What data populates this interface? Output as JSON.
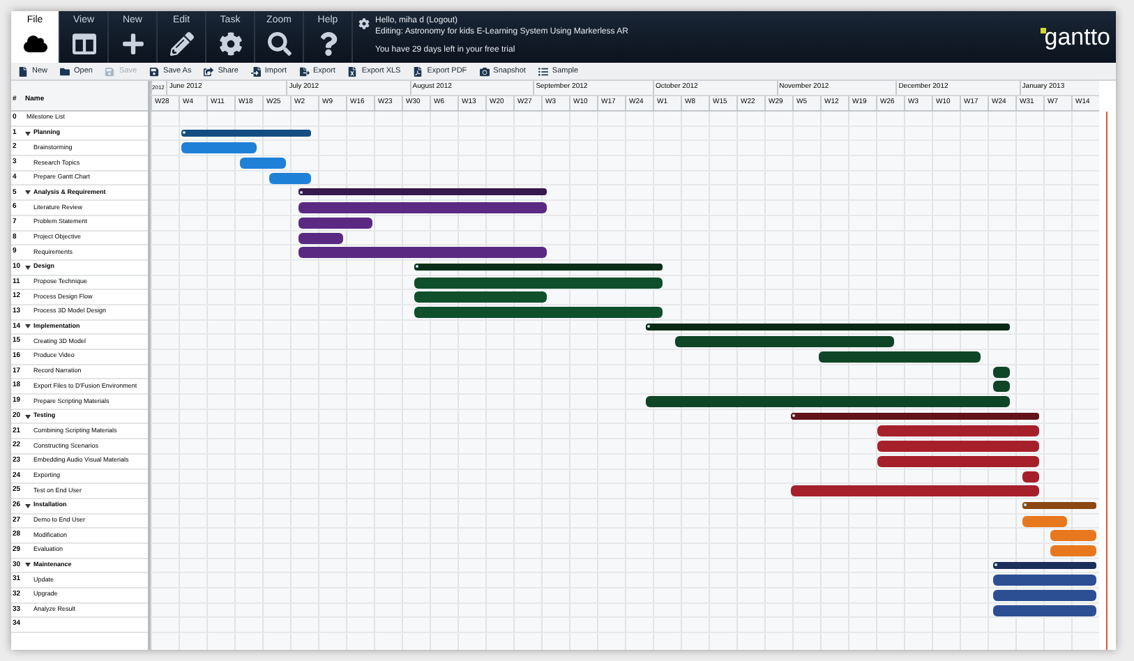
{
  "tabs": [
    {
      "label": "File",
      "selected": true
    },
    {
      "label": "View",
      "selected": false
    },
    {
      "label": "New",
      "selected": false
    },
    {
      "label": "Edit",
      "selected": false
    },
    {
      "label": "Task",
      "selected": false
    },
    {
      "label": "Zoom",
      "selected": false
    },
    {
      "label": "Help",
      "selected": false
    }
  ],
  "user": {
    "greeting": "Hello, miha d (Logout)",
    "editing": "Editing: Astronomy for kids E-Learning System Using Markerless AR",
    "trial": "You have 29 days left in your free trial"
  },
  "logo": "gantto",
  "toolbar": [
    {
      "label": "New",
      "disabled": false
    },
    {
      "label": "Open",
      "disabled": false
    },
    {
      "label": "Save",
      "disabled": true
    },
    {
      "label": "Save As",
      "disabled": false
    },
    {
      "label": "Share",
      "disabled": false
    },
    {
      "label": "Import",
      "disabled": false
    },
    {
      "label": "Export",
      "disabled": false
    },
    {
      "label": "Export XLS",
      "disabled": false
    },
    {
      "label": "Export PDF",
      "disabled": false
    },
    {
      "label": "Snapshot",
      "disabled": false
    },
    {
      "label": "Sample",
      "disabled": false
    }
  ],
  "columns": [
    "#",
    "Name"
  ],
  "timeline": {
    "months": [
      "2012",
      "June 2012",
      "July 2012",
      "August 2012",
      "September 2012",
      "October 2012",
      "November 2012",
      "December 2012",
      "January 2013"
    ],
    "weeks": [
      "W28",
      "W4",
      "W11",
      "W18",
      "W25",
      "W2",
      "W9",
      "W16",
      "W23",
      "W30",
      "W6",
      "W13",
      "W20",
      "W27",
      "W3",
      "W10",
      "W17",
      "W24",
      "W1",
      "W8",
      "W15",
      "W22",
      "W29",
      "W5",
      "W12",
      "W19",
      "W26",
      "W3",
      "W10",
      "W17",
      "W24",
      "W31",
      "W7",
      "W14"
    ]
  },
  "tasks": [
    {
      "id": "0",
      "name": "Milestone List",
      "kind": "list"
    },
    {
      "id": "1",
      "name": "Planning",
      "kind": "group",
      "expanded": true,
      "color": "#1f80d8",
      "children": [
        {
          "id": "2",
          "name": "Brainstorming",
          "kind": "task"
        },
        {
          "id": "3",
          "name": "Research Topics",
          "kind": "task"
        },
        {
          "id": "4",
          "name": "Prepare Gantt Chart",
          "kind": "task"
        }
      ]
    },
    {
      "id": "5",
      "name": "Analysis & Requirement",
      "kind": "group",
      "expanded": true,
      "color": "#5a2a82",
      "children": [
        {
          "id": "6",
          "name": "Literature Review",
          "kind": "task"
        },
        {
          "id": "7",
          "name": "Problem Statement",
          "kind": "task"
        },
        {
          "id": "8",
          "name": "Project Objective",
          "kind": "task"
        },
        {
          "id": "9",
          "name": "Requirements",
          "kind": "task"
        }
      ]
    },
    {
      "id": "10",
      "name": "Design",
      "kind": "group",
      "expanded": true,
      "color": "#0f4f2c",
      "children": [
        {
          "id": "11",
          "name": "Propose Technique",
          "kind": "task"
        },
        {
          "id": "12",
          "name": "Process Design Flow",
          "kind": "task"
        },
        {
          "id": "13",
          "name": "Process 3D Model Design",
          "kind": "task"
        }
      ]
    },
    {
      "id": "14",
      "name": "Implementation",
      "kind": "group",
      "expanded": true,
      "color": "#0e4526",
      "children": [
        {
          "id": "15",
          "name": "Creating 3D Model",
          "kind": "task"
        },
        {
          "id": "16",
          "name": "Produce Video",
          "kind": "task"
        },
        {
          "id": "17",
          "name": "Record Narration",
          "kind": "task"
        },
        {
          "id": "18",
          "name": "Export Files to D'Fusion Environment",
          "kind": "task"
        },
        {
          "id": "19",
          "name": "Prepare Scripting Materials",
          "kind": "task"
        }
      ]
    },
    {
      "id": "20",
      "name": "Testing",
      "kind": "group",
      "expanded": true,
      "color": "#a5202a",
      "children": [
        {
          "id": "21",
          "name": "Combining Scripting Materials",
          "kind": "task"
        },
        {
          "id": "22",
          "name": "Constructing Scenarios",
          "kind": "task"
        },
        {
          "id": "23",
          "name": "Embedding Audio Visual Materials",
          "kind": "task"
        },
        {
          "id": "24",
          "name": "Exporting",
          "kind": "task"
        },
        {
          "id": "25",
          "name": "Test on End User",
          "kind": "task"
        }
      ]
    },
    {
      "id": "26",
      "name": "Installation",
      "kind": "group",
      "expanded": true,
      "color": "#e8781e",
      "children": [
        {
          "id": "27",
          "name": "Demo to End User",
          "kind": "task"
        },
        {
          "id": "28",
          "name": "Modification",
          "kind": "task"
        },
        {
          "id": "29",
          "name": "Evaluation",
          "kind": "task"
        }
      ]
    },
    {
      "id": "30",
      "name": "Maintenance",
      "kind": "group",
      "expanded": true,
      "color": "#2c4f94",
      "children": [
        {
          "id": "31",
          "name": "Update",
          "kind": "task"
        },
        {
          "id": "32",
          "name": "Upgrade",
          "kind": "task"
        },
        {
          "id": "33",
          "name": "Analyze Result",
          "kind": "task"
        }
      ]
    },
    {
      "id": "34",
      "kind": "empty"
    }
  ]
}
